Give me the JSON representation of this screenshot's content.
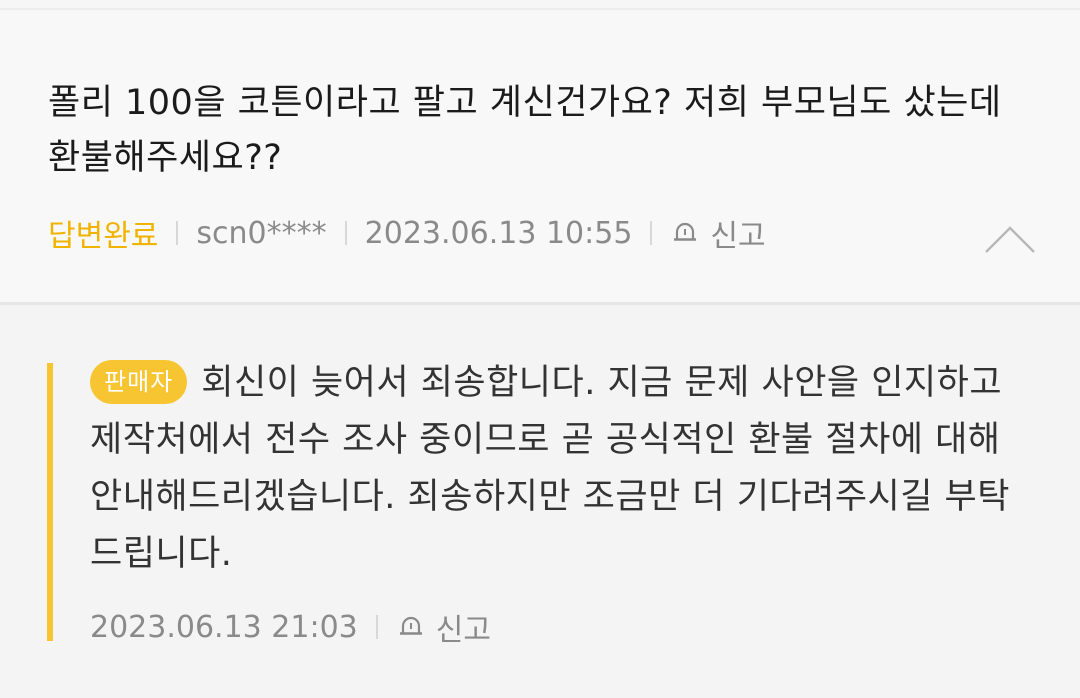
{
  "question": {
    "text": "폴리 100을 코튼이라고 팔고 계신건가요? 저희 부모님도 샀는데 환불해주세요??",
    "status": "답변완료",
    "author": "scn0****",
    "datetime": "2023.06.13 10:55",
    "report_label": "신고"
  },
  "answer": {
    "badge": "판매자",
    "text": "회신이 늦어서 죄송합니다. 지금 문제 사안을 인지하고 제작처에서 전수 조사 중이므로 곧 공식적인 환불 절차에 대해 안내해드리겠습니다. 죄송하지만 조금만 더 기다려주시길 부탁드립니다.",
    "datetime": "2023.06.13 21:03",
    "report_label": "신고"
  },
  "colors": {
    "accent": "#f7c531",
    "status": "#f0b400",
    "meta": "#8a8a8a",
    "text": "#1b1b1b"
  },
  "icons": {
    "report": "siren-icon",
    "collapse": "chevron-up-icon"
  }
}
